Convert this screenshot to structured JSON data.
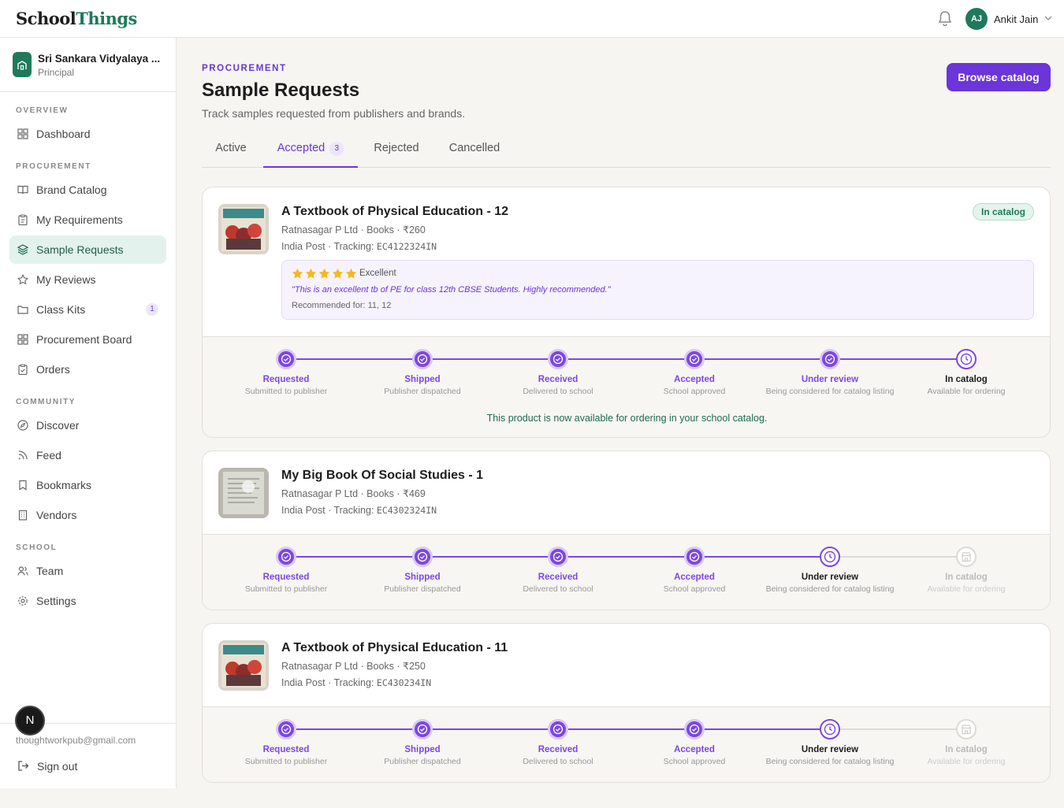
{
  "brand": {
    "part1": "School",
    "part2": "Things"
  },
  "user": {
    "initials": "AJ",
    "name": "Ankit Jain"
  },
  "org": {
    "name": "Sri Sankara Vidyalaya ...",
    "role": "Principal"
  },
  "sidebar": {
    "sections": [
      {
        "label": "OVERVIEW",
        "items": [
          {
            "label": "Dashboard",
            "icon": "grid-icon"
          }
        ]
      },
      {
        "label": "PROCUREMENT",
        "items": [
          {
            "label": "Brand Catalog",
            "icon": "book-open-icon"
          },
          {
            "label": "My Requirements",
            "icon": "clipboard-icon"
          },
          {
            "label": "Sample Requests",
            "icon": "layers-icon",
            "active": true
          },
          {
            "label": "My Reviews",
            "icon": "star-icon"
          },
          {
            "label": "Class Kits",
            "icon": "folder-icon",
            "badge": "1"
          },
          {
            "label": "Procurement Board",
            "icon": "grid-icon"
          },
          {
            "label": "Orders",
            "icon": "clipboard-check-icon"
          }
        ]
      },
      {
        "label": "COMMUNITY",
        "items": [
          {
            "label": "Discover",
            "icon": "compass-icon"
          },
          {
            "label": "Feed",
            "icon": "rss-icon"
          },
          {
            "label": "Bookmarks",
            "icon": "bookmark-icon"
          },
          {
            "label": "Vendors",
            "icon": "building-icon"
          }
        ]
      },
      {
        "label": "SCHOOL",
        "items": [
          {
            "label": "Team",
            "icon": "users-icon"
          },
          {
            "label": "Settings",
            "icon": "gear-icon"
          }
        ]
      }
    ],
    "email": "thoughtworkpub@gmail.com",
    "signout": "Sign out",
    "n_badge": "N"
  },
  "header": {
    "eyebrow": "PROCUREMENT",
    "title": "Sample Requests",
    "subtitle": "Track samples requested from publishers and brands.",
    "browse_button": "Browse catalog"
  },
  "tabs": [
    {
      "label": "Active"
    },
    {
      "label": "Accepted",
      "count": "3",
      "active": true
    },
    {
      "label": "Rejected"
    },
    {
      "label": "Cancelled"
    }
  ],
  "steps": [
    {
      "name": "Requested",
      "desc": "Submitted to publisher"
    },
    {
      "name": "Shipped",
      "desc": "Publisher dispatched"
    },
    {
      "name": "Received",
      "desc": "Delivered to school"
    },
    {
      "name": "Accepted",
      "desc": "School approved"
    },
    {
      "name": "Under review",
      "desc": "Being considered for catalog listing"
    },
    {
      "name": "In catalog",
      "desc": "Available for ordering"
    }
  ],
  "requests": [
    {
      "title": "A Textbook of Physical Education - 12",
      "meta": "Ratnasagar P Ltd · Books · ₹260",
      "carrier": "India Post · Tracking: ",
      "tracking": "EC4122324IN",
      "badge": "In catalog",
      "review": {
        "rating": 5,
        "label": "Excellent",
        "quote": "\"This is an excellent tb of PE for class 12th CBSE Students. Highly recommended.\"",
        "recommended": "Recommended for: 11, 12"
      },
      "statuses": [
        "done",
        "done",
        "done",
        "done",
        "done",
        "current"
      ],
      "message": "This product is now available for ordering in your school catalog."
    },
    {
      "title": "My Big Book Of Social Studies - 1",
      "meta": "Ratnasagar P Ltd · Books · ₹469",
      "carrier": "India Post · Tracking: ",
      "tracking": "EC4302324IN",
      "statuses": [
        "done",
        "done",
        "done",
        "done",
        "current",
        "pending"
      ]
    },
    {
      "title": "A Textbook of Physical Education - 11",
      "meta": "Ratnasagar P Ltd · Books · ₹250",
      "carrier": "India Post · Tracking: ",
      "tracking": "EC430234IN",
      "statuses": [
        "done",
        "done",
        "done",
        "done",
        "current",
        "pending"
      ]
    }
  ],
  "colors": {
    "accent": "#6b35d9",
    "brand": "#1e7a5a",
    "pending": "#dcdad4"
  }
}
